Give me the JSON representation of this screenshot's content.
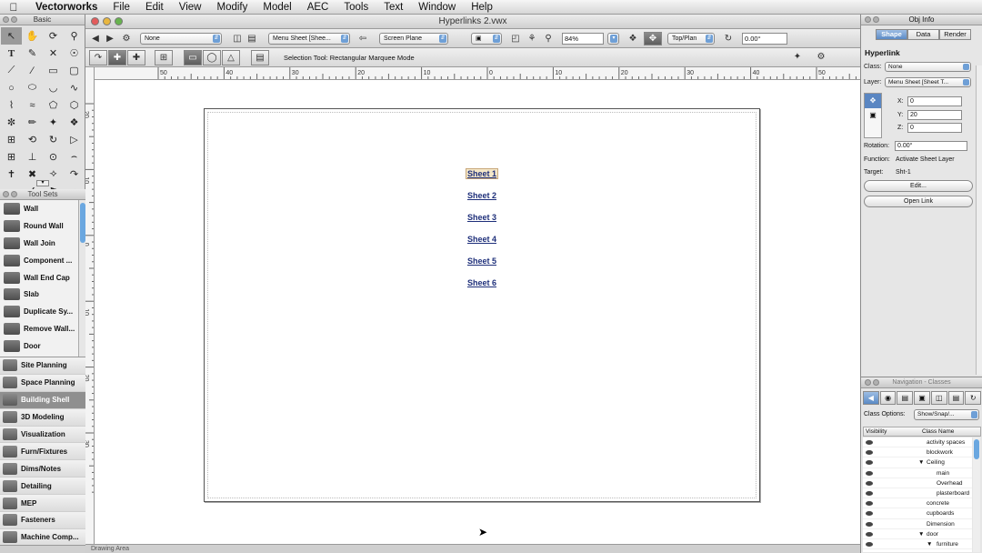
{
  "menubar": {
    "app": "Vectorworks",
    "items": [
      "File",
      "Edit",
      "View",
      "Modify",
      "Model",
      "AEC",
      "Tools",
      "Text",
      "Window",
      "Help"
    ]
  },
  "basic_palette": {
    "title": "Basic"
  },
  "tool_sets": {
    "title": "Tool Sets",
    "tools": [
      "Wall",
      "Round Wall",
      "Wall Join",
      "Component ...",
      "Wall End Cap",
      "Slab",
      "Duplicate Sy...",
      "Remove Wall...",
      "Door"
    ],
    "categories": [
      "Site Planning",
      "Space Planning",
      "Building Shell",
      "3D Modeling",
      "Visualization",
      "Furn/Fixtures",
      "Dims/Notes",
      "Detailing",
      "MEP",
      "Fasteners",
      "Machine Comp..."
    ]
  },
  "document": {
    "title": "Hyperlinks 2.vwx",
    "view_bar": {
      "class_value": "None",
      "layer_value": "Menu Sheet [Shee...",
      "plane_value": "Screen Plane",
      "zoom_value": "84%",
      "view_value": "Top/Plan",
      "rotation_value": "0.00°"
    },
    "mode_text": "Selection Tool: Rectangular Marquee Mode",
    "ruler_h_labels": [
      "50",
      "40",
      "30",
      "20",
      "10",
      "0",
      "10",
      "20",
      "30",
      "40",
      "50"
    ],
    "ruler_v_labels": [
      "20",
      "10",
      "0",
      "10",
      "20",
      "30"
    ],
    "links": [
      "Sheet 1",
      "Sheet 2",
      "Sheet 3",
      "Sheet 4",
      "Sheet 5",
      "Sheet 6"
    ],
    "status": "Drawing Area"
  },
  "obj_info": {
    "title": "Obj Info",
    "tabs": [
      "Shape",
      "Data",
      "Render"
    ],
    "object_type": "Hyperlink",
    "class_label": "Class:",
    "class_value": "None",
    "layer_label": "Layer:",
    "layer_value": "Menu Sheet [Sheet T...",
    "x_label": "X:",
    "x_value": "0",
    "y_label": "Y:",
    "y_value": "20",
    "z_label": "Z:",
    "z_value": "0",
    "rotation_label": "Rotation:",
    "rotation_value": "0.00°",
    "function_label": "Function:",
    "function_value": "Activate Sheet Layer",
    "target_label": "Target:",
    "target_value": "Sht-1",
    "edit_button": "Edit...",
    "open_link_button": "Open Link"
  },
  "navigation": {
    "title": "Navigation - Classes",
    "class_options_label": "Class Options:",
    "class_options_value": "Show/Snap/...",
    "col_visibility": "Visibility",
    "col_class_name": "Class Name",
    "classes": [
      {
        "name": "activity spaces",
        "indent": 0,
        "expander": ""
      },
      {
        "name": "blockwork",
        "indent": 0,
        "expander": ""
      },
      {
        "name": "Ceiling",
        "indent": 0,
        "expander": "▼"
      },
      {
        "name": "main",
        "indent": 1,
        "expander": ""
      },
      {
        "name": "Overhead",
        "indent": 1,
        "expander": ""
      },
      {
        "name": "plasterboard",
        "indent": 1,
        "expander": ""
      },
      {
        "name": "concrete",
        "indent": 0,
        "expander": ""
      },
      {
        "name": "cupboards",
        "indent": 0,
        "expander": ""
      },
      {
        "name": "Dimension",
        "indent": 0,
        "expander": ""
      },
      {
        "name": "door",
        "indent": 0,
        "expander": "▼"
      },
      {
        "name": "furniture",
        "indent": 1,
        "expander": "▼"
      }
    ]
  }
}
